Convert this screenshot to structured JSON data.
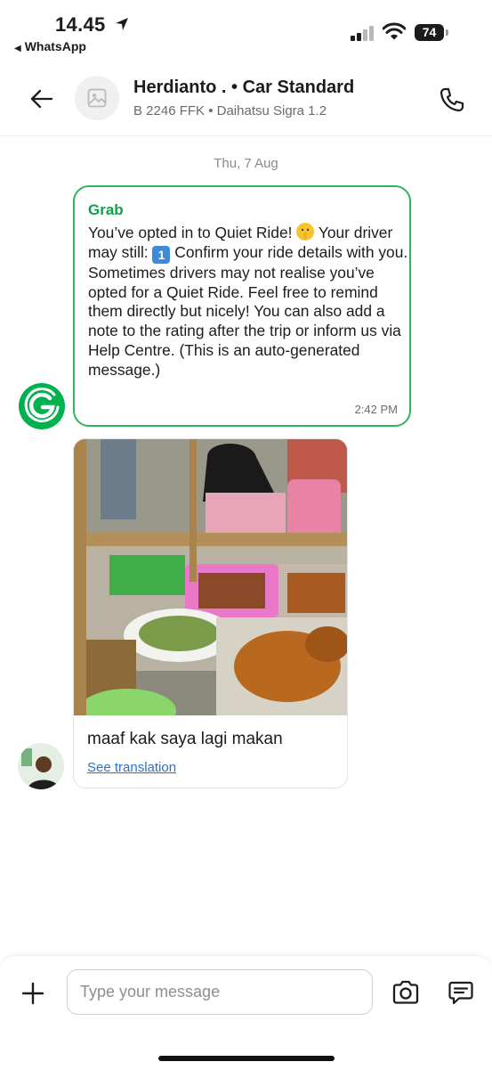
{
  "status_bar": {
    "time": "14.45",
    "back_app": "WhatsApp",
    "battery": "74"
  },
  "header": {
    "title": "Herdianto . • Car Standard",
    "subtitle": "B 2246 FFK • Daihatsu Sigra 1.2"
  },
  "chat": {
    "date": "Thu, 7 Aug",
    "messages": [
      {
        "sender": "Grab",
        "text_part1": "You’ve opted in to Quiet Ride! ",
        "text_part2": " Your driver may still: ",
        "text_part3": " Confirm your ride details with you. Sometimes drivers may not realise you’ve opted for a Quiet Ride. Feel free to remind them directly but nicely! You can also add a note to the rating after the trip or inform us via Help Centre. (This is an auto-generated message.)",
        "time": "2:42 PM"
      },
      {
        "caption": "maaf kak saya lagi makan",
        "translate_link": "See translation"
      }
    ]
  },
  "composer": {
    "placeholder": "Type your message"
  },
  "colors": {
    "grab_green": "#00b14f",
    "link_blue": "#2b72c4"
  },
  "icons": [
    "arrow-left-icon",
    "image-placeholder-icon",
    "phone-icon",
    "plus-icon",
    "camera-icon",
    "message-icon",
    "location-arrow-icon",
    "wifi-icon"
  ]
}
